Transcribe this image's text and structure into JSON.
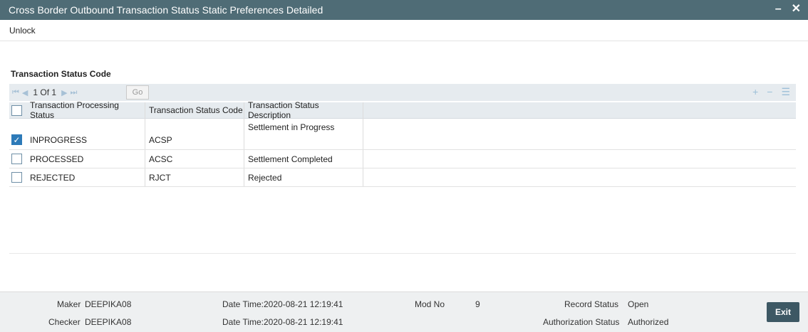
{
  "window": {
    "title": "Cross Border Outbound Transaction Status Static Preferences Detailed",
    "minimize": "–",
    "close": "✕"
  },
  "toolbar": {
    "unlock_label": "Unlock"
  },
  "section": {
    "title": "Transaction Status Code"
  },
  "pagination": {
    "label": "1 Of 1",
    "go_label": "Go"
  },
  "grid": {
    "columns": [
      "Transaction Processing Status",
      "Transaction Status Code",
      "Transaction Status Description"
    ],
    "rows": [
      {
        "checked": true,
        "processing_status": "INPROGRESS",
        "status_code": "ACSP",
        "description": "Settlement in Progress"
      },
      {
        "checked": false,
        "processing_status": "PROCESSED",
        "status_code": "ACSC",
        "description": "Settlement Completed"
      },
      {
        "checked": false,
        "processing_status": "REJECTED",
        "status_code": "RJCT",
        "description": "Rejected"
      }
    ]
  },
  "footer": {
    "maker_label": "Maker",
    "maker": "DEEPIKA08",
    "checker_label": "Checker",
    "checker": "DEEPIKA08",
    "date_time_label": "Date Time:",
    "maker_date_time": "2020-08-21 12:19:41",
    "checker_date_time": "2020-08-21 12:19:41",
    "mod_no_label": "Mod No",
    "mod_no": "9",
    "record_status_label": "Record Status",
    "record_status": "Open",
    "authorization_status_label": "Authorization Status",
    "authorization_status": "Authorized",
    "exit_label": "Exit"
  },
  "colors": {
    "titlebar": "#4f6c76",
    "exit_button": "#3d5864",
    "checkbox_checked": "#2d7ab8",
    "grid_header": "#e6ebef"
  },
  "icons": [
    "first-page-icon",
    "prev-page-icon",
    "next-page-icon",
    "last-page-icon",
    "add-row-icon",
    "delete-row-icon",
    "single-view-icon",
    "checkmark-icon"
  ]
}
